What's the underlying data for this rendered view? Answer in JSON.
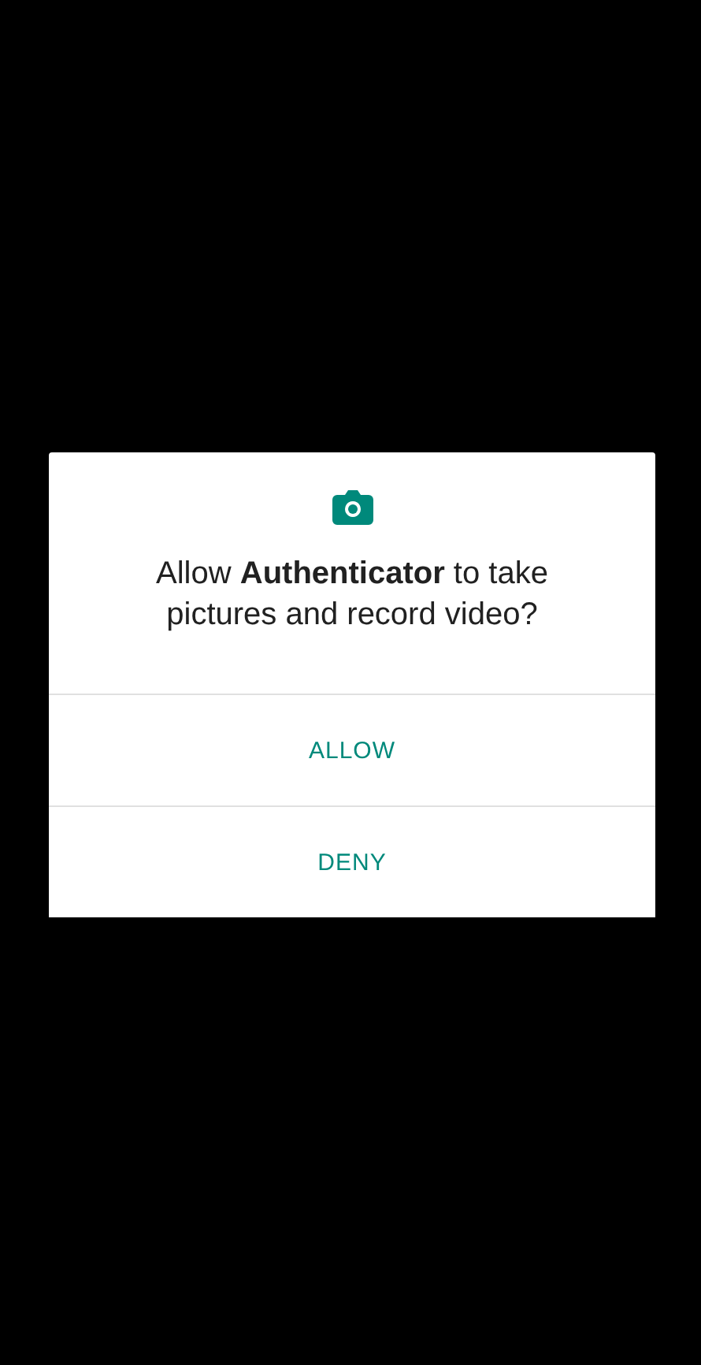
{
  "dialog": {
    "message": "Allow **Authenticator** to take pictures and record video?",
    "buttons": [
      {
        "label": "ALLOW"
      },
      {
        "label": "DENY"
      }
    ]
  }
}
